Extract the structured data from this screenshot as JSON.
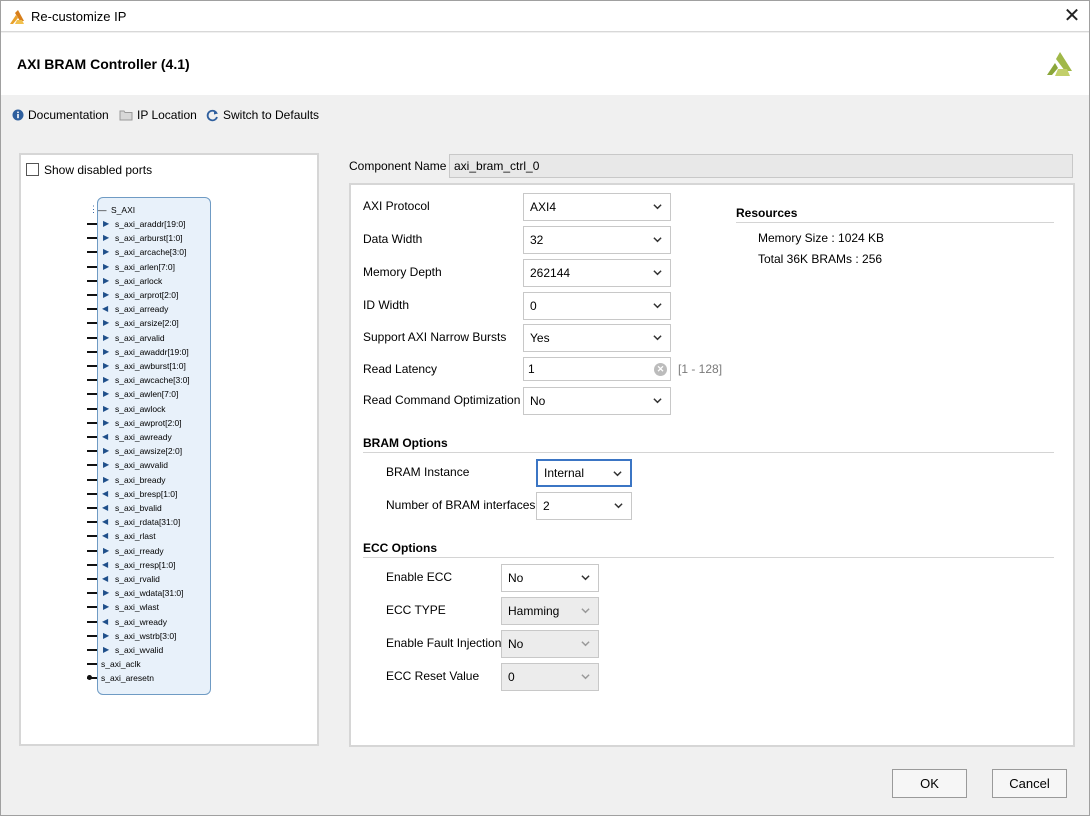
{
  "window": {
    "title": "Re-customize IP"
  },
  "header": {
    "ip_name": "AXI BRAM Controller (4.1)"
  },
  "toolbar": {
    "documentation": "Documentation",
    "ip_location": "IP Location",
    "switch_defaults": "Switch to Defaults"
  },
  "left_panel": {
    "show_disabled_label": "Show disabled ports",
    "show_disabled_checked": false,
    "interface_name": "S_AXI",
    "ports": [
      {
        "name": "s_axi_araddr[19:0]",
        "dir": "in"
      },
      {
        "name": "s_axi_arburst[1:0]",
        "dir": "in"
      },
      {
        "name": "s_axi_arcache[3:0]",
        "dir": "in"
      },
      {
        "name": "s_axi_arlen[7:0]",
        "dir": "in"
      },
      {
        "name": "s_axi_arlock",
        "dir": "in"
      },
      {
        "name": "s_axi_arprot[2:0]",
        "dir": "in"
      },
      {
        "name": "s_axi_arready",
        "dir": "out"
      },
      {
        "name": "s_axi_arsize[2:0]",
        "dir": "in"
      },
      {
        "name": "s_axi_arvalid",
        "dir": "in"
      },
      {
        "name": "s_axi_awaddr[19:0]",
        "dir": "in"
      },
      {
        "name": "s_axi_awburst[1:0]",
        "dir": "in"
      },
      {
        "name": "s_axi_awcache[3:0]",
        "dir": "in"
      },
      {
        "name": "s_axi_awlen[7:0]",
        "dir": "in"
      },
      {
        "name": "s_axi_awlock",
        "dir": "in"
      },
      {
        "name": "s_axi_awprot[2:0]",
        "dir": "in"
      },
      {
        "name": "s_axi_awready",
        "dir": "out"
      },
      {
        "name": "s_axi_awsize[2:0]",
        "dir": "in"
      },
      {
        "name": "s_axi_awvalid",
        "dir": "in"
      },
      {
        "name": "s_axi_bready",
        "dir": "in"
      },
      {
        "name": "s_axi_bresp[1:0]",
        "dir": "out"
      },
      {
        "name": "s_axi_bvalid",
        "dir": "out"
      },
      {
        "name": "s_axi_rdata[31:0]",
        "dir": "out"
      },
      {
        "name": "s_axi_rlast",
        "dir": "out"
      },
      {
        "name": "s_axi_rready",
        "dir": "in"
      },
      {
        "name": "s_axi_rresp[1:0]",
        "dir": "out"
      },
      {
        "name": "s_axi_rvalid",
        "dir": "out"
      },
      {
        "name": "s_axi_wdata[31:0]",
        "dir": "in"
      },
      {
        "name": "s_axi_wlast",
        "dir": "in"
      },
      {
        "name": "s_axi_wready",
        "dir": "out"
      },
      {
        "name": "s_axi_wstrb[3:0]",
        "dir": "in"
      },
      {
        "name": "s_axi_wvalid",
        "dir": "in"
      }
    ],
    "clock_port": "s_axi_aclk",
    "reset_port": "s_axi_aresetn"
  },
  "config": {
    "component_name_label": "Component Name",
    "component_name_value": "axi_bram_ctrl_0",
    "axi_protocol_label": "AXI Protocol",
    "axi_protocol_value": "AXI4",
    "data_width_label": "Data Width",
    "data_width_value": "32",
    "memory_depth_label": "Memory Depth",
    "memory_depth_value": "262144",
    "id_width_label": "ID Width",
    "id_width_value": "0",
    "narrow_bursts_label": "Support AXI Narrow Bursts",
    "narrow_bursts_value": "Yes",
    "read_latency_label": "Read Latency",
    "read_latency_value": "1",
    "read_latency_range": "[1 - 128]",
    "read_cmd_opt_label": "Read Command Optimization",
    "read_cmd_opt_value": "No",
    "bram_section": "BRAM Options",
    "bram_instance_label": "BRAM Instance",
    "bram_instance_value": "Internal",
    "num_bram_if_label": "Number of BRAM interfaces",
    "num_bram_if_value": "2",
    "ecc_section": "ECC Options",
    "enable_ecc_label": "Enable ECC",
    "enable_ecc_value": "No",
    "ecc_type_label": "ECC TYPE",
    "ecc_type_value": "Hamming",
    "fault_inj_label": "Enable Fault Injection",
    "fault_inj_value": "No",
    "ecc_reset_label": "ECC Reset Value",
    "ecc_reset_value": "0"
  },
  "resources": {
    "title": "Resources",
    "memory_size": "Memory Size : 1024 KB",
    "total_brams": "Total 36K BRAMs : 256"
  },
  "buttons": {
    "ok": "OK",
    "cancel": "Cancel"
  },
  "colors": {
    "accent": "#3b75c4",
    "symbol_fill": "#e8f1fa",
    "brand": "#8aa63a"
  }
}
